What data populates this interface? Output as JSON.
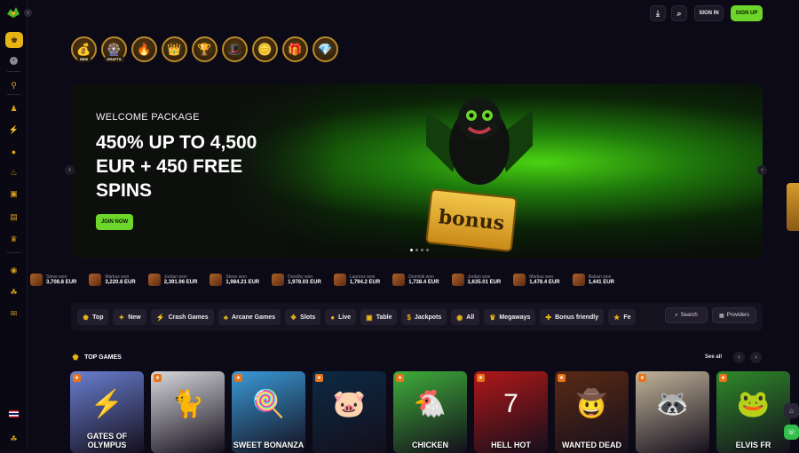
{
  "topbar": {
    "download_icon": "download-icon",
    "search_icon": "search-icon",
    "signin_label": "SIGN IN",
    "signup_label": "SIGN UP"
  },
  "sidebar": {
    "items": [
      "crown-icon",
      "chat-icon",
      "lollipop-icon",
      "bag-icon",
      "bolt-icon",
      "coins-icon",
      "fire-icon",
      "gift-icon",
      "treasure-icon",
      "crown-small-icon",
      "chip-icon",
      "leprechaun-icon",
      "bonus-icon"
    ]
  },
  "promos": [
    {
      "icon": "treasure-icon",
      "tag": "NEW"
    },
    {
      "icon": "wheel-icon",
      "tag": "DRAFTS"
    },
    {
      "icon": "flame-icon",
      "tag": ""
    },
    {
      "icon": "crown-icon",
      "tag": ""
    },
    {
      "icon": "trophy-icon",
      "tag": ""
    },
    {
      "icon": "hat-icon",
      "tag": ""
    },
    {
      "icon": "coins-icon",
      "tag": ""
    },
    {
      "icon": "gift-icon",
      "tag": ""
    },
    {
      "icon": "gem-icon",
      "tag": ""
    }
  ],
  "hero": {
    "welcome": "WELCOME PACKAGE",
    "headline": "450% UP TO 4,500 EUR + 450 FREE SPINS",
    "cta": "JOIN NOW",
    "bonus_text": "bonus"
  },
  "wins": [
    {
      "who": "Steve won",
      "amt": "3,708.8 EUR"
    },
    {
      "who": "Markus won",
      "amt": "3,220.8 EUR"
    },
    {
      "who": "Jordan won",
      "amt": "2,391.96 EUR"
    },
    {
      "who": "Steve won",
      "amt": "1,984.21 EUR"
    },
    {
      "who": "Dorothy won",
      "amt": "1,978.03 EUR"
    },
    {
      "who": "Laurenz won",
      "amt": "1,794.2 EUR"
    },
    {
      "who": "Dominik won",
      "amt": "1,738.4 EUR"
    },
    {
      "who": "Jordan won",
      "amt": "1,635.01 EUR"
    },
    {
      "who": "Markus won",
      "amt": "1,478.4 EUR"
    },
    {
      "who": "Balsan won",
      "amt": "1,441 EUR"
    }
  ],
  "filters": [
    {
      "label": "Top",
      "icon": "♚"
    },
    {
      "label": "New",
      "icon": "✦"
    },
    {
      "label": "Crash Games",
      "icon": "⚡"
    },
    {
      "label": "Arcane Games",
      "icon": "♣"
    },
    {
      "label": "Slots",
      "icon": "❖"
    },
    {
      "label": "Live",
      "icon": "●"
    },
    {
      "label": "Table",
      "icon": "▣"
    },
    {
      "label": "Jackpots",
      "icon": "$"
    },
    {
      "label": "All",
      "icon": "◉"
    },
    {
      "label": "Megaways",
      "icon": "♛"
    },
    {
      "label": "Bonus friendly",
      "icon": "✚"
    },
    {
      "label": "Fe",
      "icon": "★"
    }
  ],
  "search_label": "Search",
  "providers_label": "Providers",
  "top_games": {
    "title": "TOP GAMES",
    "see_all": "See all",
    "games": [
      {
        "title": "GATES OF OLYMPUS",
        "bg": "#6a7fd0",
        "art": "⚡"
      },
      {
        "title": "",
        "bg": "#d8d8dc",
        "art": "🐈"
      },
      {
        "title": "SWEET BONANZA",
        "bg": "#3a9ad8",
        "art": "🍭"
      },
      {
        "title": "",
        "bg": "#0c2a44",
        "art": "🐷"
      },
      {
        "title": "CHICKEN",
        "bg": "#3fae3a",
        "art": "🐔"
      },
      {
        "title": "HELL HOT",
        "bg": "#b01818",
        "art": "7"
      },
      {
        "title": "WANTED DEAD",
        "bg": "#5a2a14",
        "art": "🤠"
      },
      {
        "title": "",
        "bg": "#c2b49a",
        "art": "🦝"
      },
      {
        "title": "ELVIS FR",
        "bg": "#2f8a2a",
        "art": "🐸"
      }
    ]
  }
}
